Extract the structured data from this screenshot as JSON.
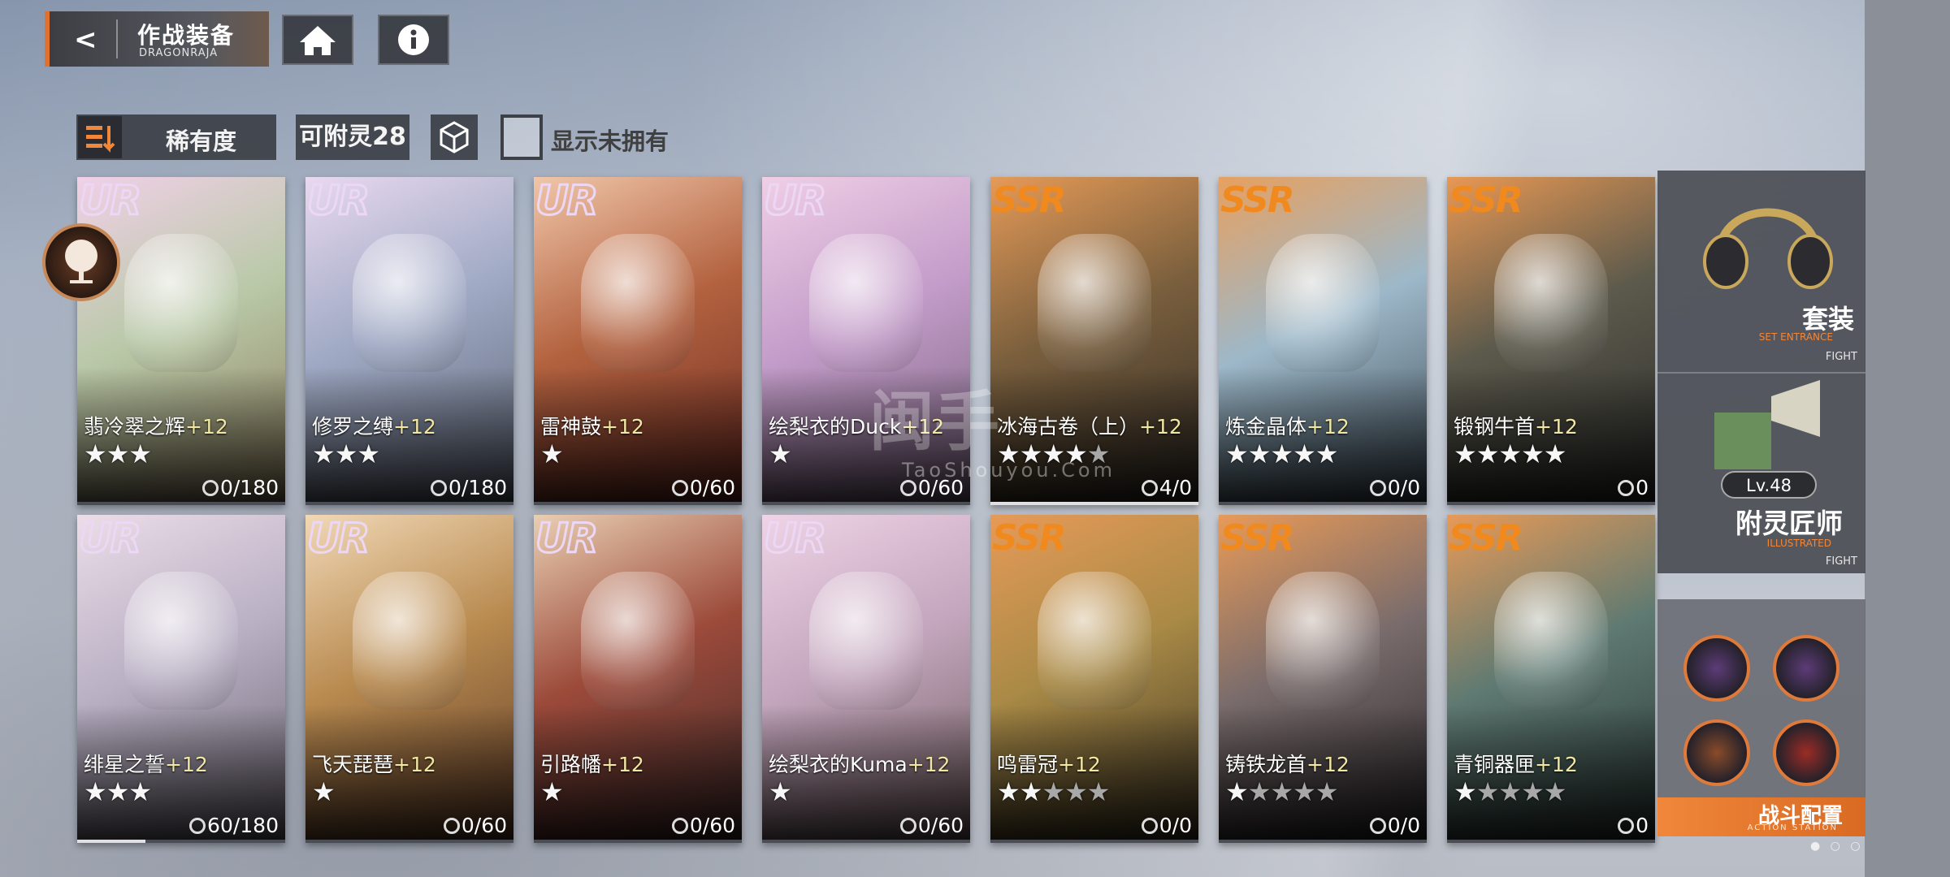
{
  "header": {
    "title": "作战装备",
    "subtitle": "DRAGONRAJA"
  },
  "filters": {
    "sort_label": "稀有度",
    "attach_count": "可附灵28",
    "show_unowned_label": "显示未拥有"
  },
  "cards": [
    {
      "rarity": "UR",
      "name": "翡冷翠之辉",
      "plus": "+12",
      "stars": 3,
      "max_stars": 3,
      "fragments": "0/180",
      "progress": 0
    },
    {
      "rarity": "UR",
      "name": "修罗之缚",
      "plus": "+12",
      "stars": 3,
      "max_stars": 3,
      "fragments": "0/180",
      "progress": 0
    },
    {
      "rarity": "UR",
      "name": "雷神鼓",
      "plus": "+12",
      "stars": 1,
      "max_stars": 1,
      "fragments": "0/60",
      "progress": 0
    },
    {
      "rarity": "UR",
      "name": "绘梨衣的Duck",
      "plus": "+12",
      "stars": 1,
      "max_stars": 1,
      "fragments": "0/60",
      "progress": 0
    },
    {
      "rarity": "SSR",
      "name": "冰海古卷（上）",
      "plus": "+12",
      "stars": 4,
      "max_stars": 5,
      "fragments": "4/0",
      "progress": 1
    },
    {
      "rarity": "SSR",
      "name": "炼金晶体",
      "plus": "+12",
      "stars": 5,
      "max_stars": 5,
      "fragments": "0/0",
      "progress": 0
    },
    {
      "rarity": "SSR",
      "name": "锻钢牛首",
      "plus": "+12",
      "stars": 5,
      "max_stars": 5,
      "fragments": "0",
      "progress": 0
    },
    {
      "rarity": "UR",
      "name": "绯星之誓",
      "plus": "+12",
      "stars": 3,
      "max_stars": 3,
      "fragments": "60/180",
      "progress": 0.33
    },
    {
      "rarity": "UR",
      "name": "飞天琵琶",
      "plus": "+12",
      "stars": 1,
      "max_stars": 1,
      "fragments": "0/60",
      "progress": 0
    },
    {
      "rarity": "UR",
      "name": "引路幡",
      "plus": "+12",
      "stars": 1,
      "max_stars": 1,
      "fragments": "0/60",
      "progress": 0
    },
    {
      "rarity": "UR",
      "name": "绘梨衣的Kuma",
      "plus": "+12",
      "stars": 1,
      "max_stars": 1,
      "fragments": "0/60",
      "progress": 0
    },
    {
      "rarity": "SSR",
      "name": "鸣雷冠",
      "plus": "+12",
      "stars": 2,
      "max_stars": 5,
      "fragments": "0/0",
      "progress": 0
    },
    {
      "rarity": "SSR",
      "name": "铸铁龙首",
      "plus": "+12",
      "stars": 1,
      "max_stars": 5,
      "fragments": "0/0",
      "progress": 0
    },
    {
      "rarity": "SSR",
      "name": "青铜器匣",
      "plus": "+12",
      "stars": 1,
      "max_stars": 5,
      "fragments": "0",
      "progress": 0
    }
  ],
  "side": {
    "set_title": "套装",
    "set_sub": "SET ENTRANCE",
    "fight": "FIGHT",
    "level": "Lv.48",
    "enchanter_title": "附灵匠师",
    "enchanter_sub": "ILLUSTRATED",
    "battle_title": "战斗配置",
    "battle_sub": "ACTION STATION"
  },
  "watermark": {
    "main": "闽手",
    "sub": "TaoShouyou.Com"
  }
}
